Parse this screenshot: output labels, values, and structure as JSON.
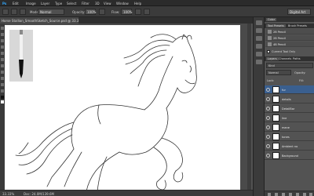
{
  "app": {
    "brand_colors": {
      "chrome": "#535353",
      "dark": "#2b2b2b",
      "selection": "#3a5f8f"
    }
  },
  "menubar": {
    "items": [
      "Ps",
      "Edit",
      "Image",
      "Layer",
      "Type",
      "Select",
      "Filter",
      "3D",
      "View",
      "Window",
      "Help"
    ]
  },
  "options_bar": {
    "mode_label": "Mode:",
    "mode_value": "Normal",
    "opacity_label": "Opacity:",
    "opacity_value": "100%",
    "flow_label": "Flow:",
    "flow_value": "100%",
    "workspace_value": "Digital Art"
  },
  "document": {
    "tab_title": "Horse Stallion_SmoothSketch_Source.psd @ 33.3% (fur, RGB/8)"
  },
  "status": {
    "zoom": "33.33%",
    "doc_size": "Doc: 24.0M/139.6M"
  },
  "panels": {
    "header_tab": "Color",
    "tool_presets_tab": "Tool Presets",
    "brush_presets_tab": "Brush Presets",
    "presets": [
      "2B Pencil",
      "2B Pencil",
      "4B Pencil"
    ],
    "current_tool_only": "Current Tool Only",
    "layers_tab": "Layers",
    "channels_tab": "Channels",
    "paths_tab": "Paths",
    "kind_value": "Kind",
    "blend_mode": "Normal",
    "opacity_short": "Opacity:",
    "lock_label": "Lock:",
    "fill_short": "Fill:",
    "layers": [
      {
        "name": "fur",
        "selected": true
      },
      {
        "name": "details",
        "selected": false
      },
      {
        "name": "DetailBar",
        "selected": false
      },
      {
        "name": "line",
        "selected": false
      },
      {
        "name": "mane",
        "selected": false
      },
      {
        "name": "tones",
        "selected": false
      },
      {
        "name": "Ambient no",
        "selected": false
      },
      {
        "name": "Background",
        "selected": false
      }
    ]
  }
}
